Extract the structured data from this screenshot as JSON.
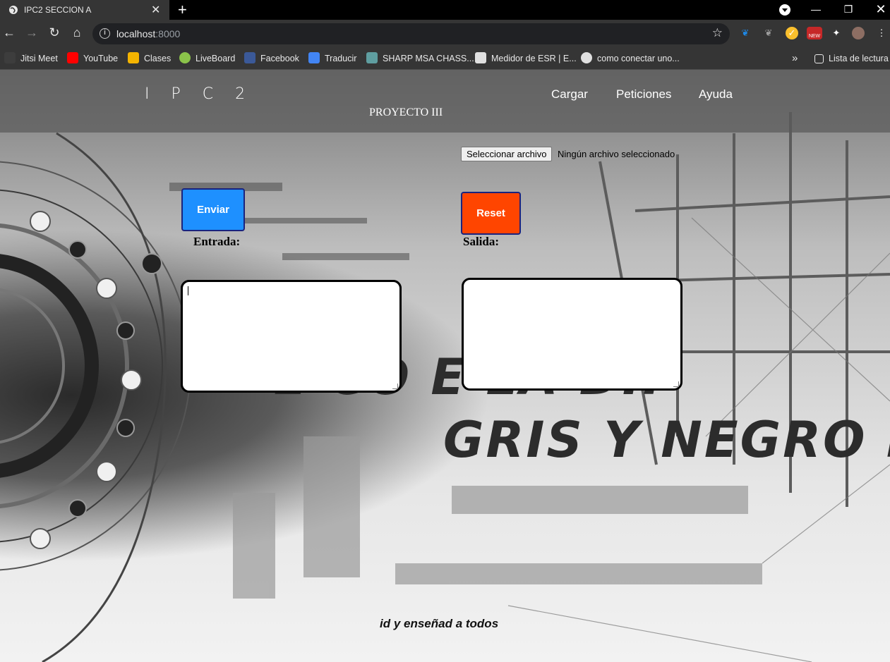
{
  "browser": {
    "tab_title": "IPC2 SECCION A",
    "new_tab": "+",
    "url_host": "localhost",
    "url_port": ":8000",
    "bookmarks": [
      {
        "label": "Jitsi Meet",
        "color": "#3d3d3d"
      },
      {
        "label": "YouTube",
        "color": "#ff0000"
      },
      {
        "label": "Clases",
        "color": "#f4b400"
      },
      {
        "label": "LiveBoard",
        "color": "#8bc34a"
      },
      {
        "label": "Facebook",
        "color": "#3b5998"
      },
      {
        "label": "Traducir",
        "color": "#4285f4"
      },
      {
        "label": "SHARP MSA CHASS...",
        "color": "#5f9ea0"
      },
      {
        "label": "Medidor de ESR | E...",
        "color": "#e0e0e0"
      },
      {
        "label": "como conectar uno...",
        "color": "#e0e0e0"
      }
    ],
    "more_bookmarks": "»",
    "reading_list": "Lista de lectura",
    "extension_badge": "NEW"
  },
  "header": {
    "brand": "I P C 2",
    "subtitle": "PROYECTO III",
    "nav": [
      "Cargar",
      "Peticiones",
      "Ayuda"
    ]
  },
  "upload": {
    "button_label": "Seleccionar archivo",
    "status": "Ningún archivo seleccionado"
  },
  "actions": {
    "send_label": "Enviar",
    "send_color": "#1e90ff",
    "reset_label": "Reset",
    "reset_color": "#ff4500"
  },
  "panels": {
    "input_label": "Entrada:",
    "output_label": "Salida:"
  },
  "background_text": {
    "line1": "E   CO     E LA DIF",
    "line2": "GRIS Y NEGRO PO"
  },
  "footer": {
    "quote": "id y enseñad a todos"
  }
}
